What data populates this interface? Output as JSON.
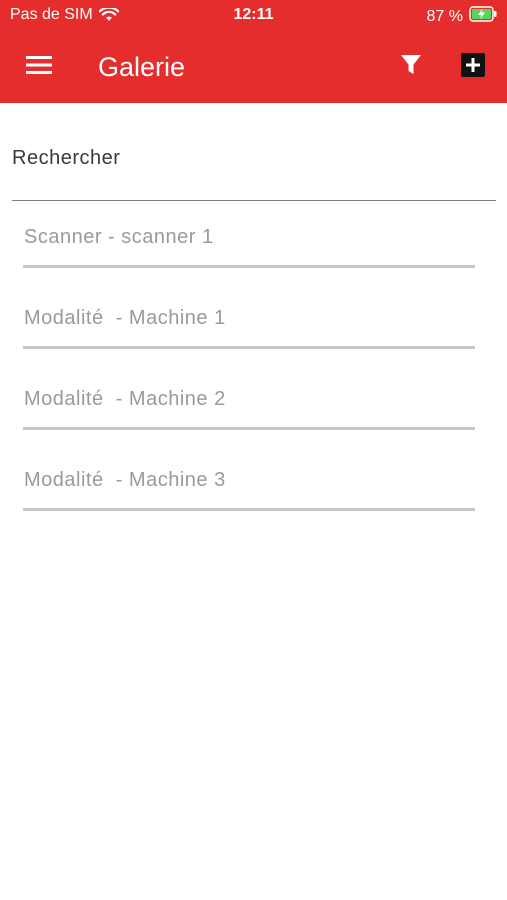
{
  "status_bar": {
    "carrier": "Pas de SIM",
    "time": "12:11",
    "battery": "87 %"
  },
  "toolbar": {
    "title": "Galerie",
    "menu_icon": "hamburger-menu-icon",
    "filter_icon": "filter-icon",
    "add_icon": "add-square-icon"
  },
  "search": {
    "placeholder": "Rechercher",
    "value": ""
  },
  "items": [
    {
      "label": "Scanner - scanner 1"
    },
    {
      "label": "Modalité  - Machine 1"
    },
    {
      "label": "Modalité  - Machine 2"
    },
    {
      "label": "Modalité  - Machine 3"
    }
  ],
  "colors": {
    "accent": "#e52d2d",
    "item_text": "#9a9a9a",
    "divider": "#c6c6c6"
  }
}
